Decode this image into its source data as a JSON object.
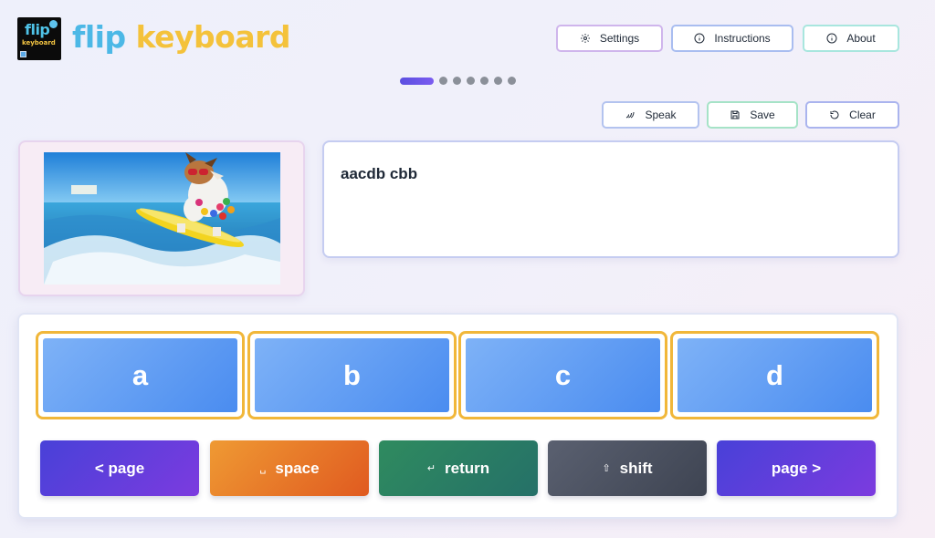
{
  "brand": {
    "logo_flip": "flip",
    "logo_keyboard": "keyboard",
    "name_part1": "flip",
    "name_part2": "keyboard"
  },
  "nav": {
    "settings": {
      "label": "Settings",
      "icon": "gear-icon"
    },
    "instructions": {
      "label": "Instructions",
      "icon": "info-icon"
    },
    "about": {
      "label": "About",
      "icon": "info-icon"
    }
  },
  "pagination": {
    "total": 7,
    "current": 1
  },
  "actions": {
    "speak": {
      "label": "Speak",
      "icon": "speaker-icon"
    },
    "save": {
      "label": "Save",
      "icon": "floppy-disk-icon"
    },
    "clear": {
      "label": "Clear",
      "icon": "undo-icon"
    }
  },
  "output": {
    "text": "aacdb cbb"
  },
  "keys": [
    {
      "label": "a"
    },
    {
      "label": "b"
    },
    {
      "label": "c"
    },
    {
      "label": "d"
    }
  ],
  "controls": {
    "page_prev": {
      "label": "< page"
    },
    "space": {
      "label": "space",
      "icon": "␣"
    },
    "return": {
      "label": "return",
      "icon": "↵"
    },
    "shift": {
      "label": "shift",
      "icon": "⇧"
    },
    "page_next": {
      "label": "page >"
    }
  },
  "colors": {
    "key_border": "#f1b73a",
    "key_fill": "#4a8cf0",
    "brand_flip": "#4cb8e6",
    "brand_keyboard": "#f4c23b"
  }
}
